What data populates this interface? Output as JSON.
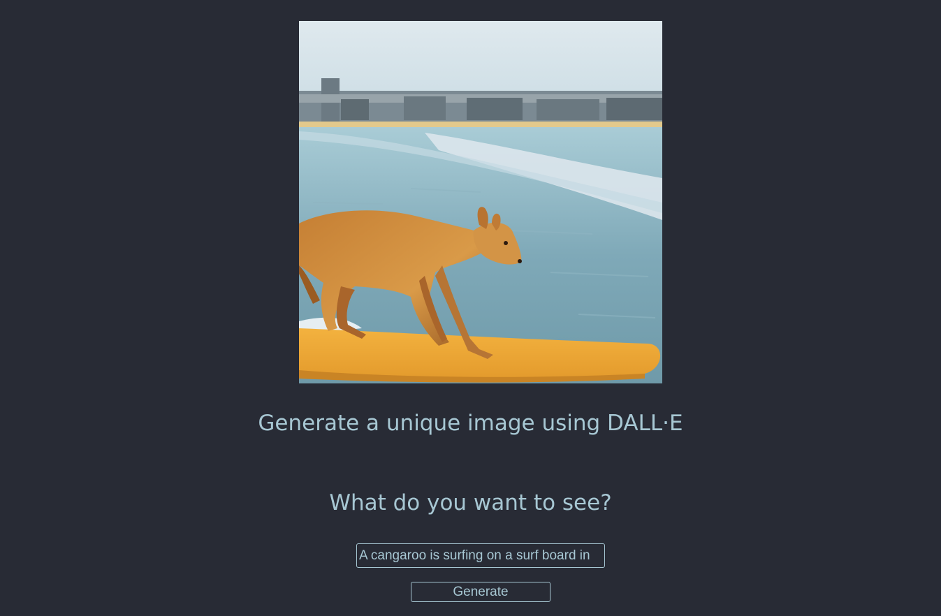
{
  "app": {
    "title": "Generate a unique image using DALL·E",
    "accent_color": "#a7c7d3",
    "background_color": "#282b35"
  },
  "image": {
    "description_icon": "generated-image"
  },
  "prompt": {
    "heading": "What do you want to see?",
    "value": "A cangaroo is surfing on a surf board in"
  },
  "actions": {
    "generate_label": "Generate"
  }
}
